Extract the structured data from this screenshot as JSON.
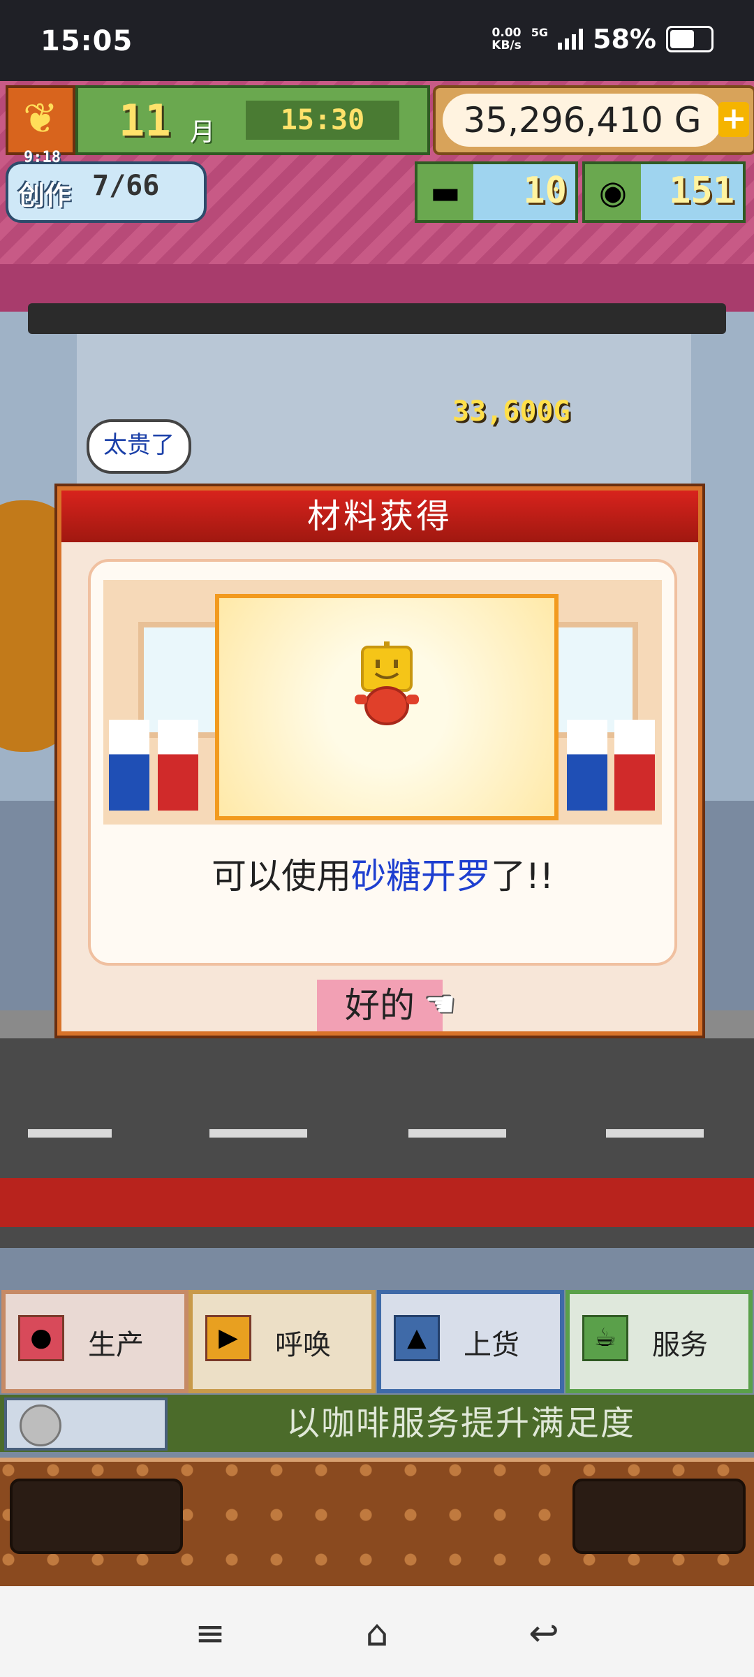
{
  "status_bar": {
    "time": "15:05",
    "net_speed_value": "0.00",
    "net_speed_unit": "KB/s",
    "network": "5G",
    "battery": "58%"
  },
  "hud": {
    "season_icon": "maple-leaf-icon",
    "month_number": "11",
    "month_label": "月",
    "clock": "15:30",
    "gold": "35,296,410 G",
    "gold_add_label": "+",
    "create": {
      "label": "创作",
      "timer": "9:18",
      "progress": "7/66"
    },
    "gold_bar_count": "10",
    "silver_coin_count": "151"
  },
  "scene": {
    "floating_price": "33,600G",
    "customer_bubble": "太贵了"
  },
  "dialog": {
    "title": "材料获得",
    "message_prefix": "可以使用",
    "message_item": "砂糖开罗",
    "message_suffix": "了!!",
    "ok_label": "好的",
    "colors": {
      "header": "#c01d14",
      "highlight": "#1e3fd0",
      "ok_button": "#f2a0b4"
    }
  },
  "menu": {
    "buttons": [
      {
        "label": "生产",
        "icon": "bread-icon"
      },
      {
        "label": "呼唤",
        "icon": "flag-icon"
      },
      {
        "label": "上货",
        "icon": "cake-icon"
      },
      {
        "label": "服务",
        "icon": "coffee-cup-icon"
      }
    ]
  },
  "service_bar": {
    "text": "以咖啡服务提升满足度"
  },
  "navbar": {
    "menu_icon": "≡",
    "home_icon": "⌂",
    "back_icon": "↩"
  }
}
